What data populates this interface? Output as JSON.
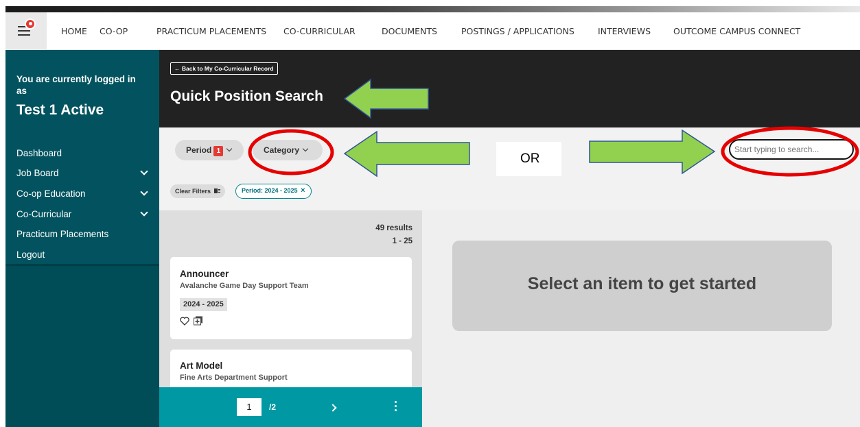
{
  "nav": {
    "items": [
      "HOME",
      "CO-OP",
      "PRACTICUM PLACEMENTS",
      "CO-CURRICULAR",
      "DOCUMENTS",
      "POSTINGS / APPLICATIONS",
      "INTERVIEWS",
      "OUTCOME CAMPUS CONNECT"
    ]
  },
  "sidebar": {
    "logged_in_label": "You are currently logged in as",
    "username": "Test 1 Active",
    "items": [
      {
        "label": "Dashboard"
      },
      {
        "label": "Job Board"
      },
      {
        "label": "Co-op Education"
      },
      {
        "label": "Co-Curricular"
      },
      {
        "label": "Practicum Placements"
      },
      {
        "label": "Logout"
      }
    ]
  },
  "header": {
    "back_label": "← Back to My Co-Curricular Record",
    "title": "Quick Position Search"
  },
  "filters": {
    "period_label": "Period",
    "period_count": "1",
    "category_label": "Category",
    "search_placeholder": "Start typing to search...",
    "clear_label": "Clear Filters",
    "active_chip": "Period: 2024 - 2025"
  },
  "results": {
    "count": "49 results",
    "range": "1 - 25",
    "cards": [
      {
        "title": "Announcer",
        "org": "Avalanche Game Day Support Team",
        "tag": "2024 - 2025"
      },
      {
        "title": "Art Model",
        "org": "Fine Arts Department Support"
      }
    ]
  },
  "pager": {
    "current": "1",
    "total": "/2"
  },
  "detail": {
    "placeholder": "Select an item to get started"
  },
  "annotation": {
    "or_label": "OR",
    "arrow_color": "#92d050",
    "circle_color": "#e60000"
  }
}
